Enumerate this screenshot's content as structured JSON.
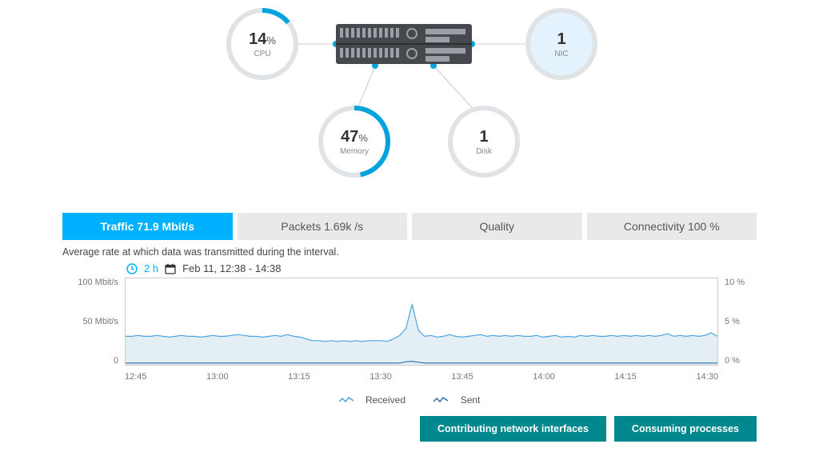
{
  "gauges": {
    "cpu": {
      "value": "14",
      "unit": "%",
      "label": "CPU",
      "pct": 14,
      "filled": false
    },
    "memory": {
      "value": "47",
      "unit": "%",
      "label": "Memory",
      "pct": 47,
      "filled": false
    },
    "disk": {
      "value": "1",
      "unit": "",
      "label": "Disk",
      "pct": 0,
      "filled": false
    },
    "nic": {
      "value": "1",
      "unit": "",
      "label": "NIC",
      "pct": 0,
      "filled": true
    }
  },
  "tabs": [
    {
      "label": "Traffic 71.9 Mbit/s",
      "active": true
    },
    {
      "label": "Packets 1.69k /s",
      "active": false
    },
    {
      "label": "Quality",
      "active": false
    },
    {
      "label": "Connectivity 100 %",
      "active": false
    }
  ],
  "chart_desc": "Average rate at which data was transmitted during the interval.",
  "time_picker": {
    "range": "2 h",
    "window": "Feb 11, 12:38 - 14:38"
  },
  "chart_data": {
    "type": "area",
    "title": "",
    "xlabel": "",
    "ylabel_left": "Mbit/s",
    "ylabel_right": "%",
    "ylim_left": [
      0,
      100
    ],
    "ylim_right": [
      0,
      10
    ],
    "y_ticks_left": [
      "100 Mbit/s",
      "50 Mbit/s",
      "0"
    ],
    "y_ticks_right": [
      "10 %",
      "5 %",
      "0 %"
    ],
    "x_ticks": [
      "12:45",
      "13:00",
      "13:15",
      "13:30",
      "13:45",
      "14:00",
      "14:15",
      "14:30"
    ],
    "series": [
      {
        "name": "Received",
        "color": "#4aa3df",
        "fill": "#e4eef5",
        "values": [
          33,
          33,
          34,
          33,
          33,
          34,
          33,
          32,
          33,
          34,
          33,
          33,
          32,
          33,
          34,
          33,
          33,
          34,
          35,
          34,
          33,
          33,
          32,
          33,
          34,
          33,
          35,
          33,
          32,
          30,
          28,
          28,
          27,
          28,
          27,
          28,
          27,
          28,
          27,
          28,
          28,
          28,
          27,
          30,
          34,
          42,
          70,
          40,
          33,
          34,
          32,
          33,
          35,
          33,
          32,
          33,
          34,
          35,
          33,
          34,
          33,
          34,
          33,
          34,
          33,
          33,
          34,
          32,
          33,
          34,
          32,
          33,
          32,
          34,
          33,
          34,
          33,
          33,
          34,
          33,
          34,
          33,
          34,
          33,
          34,
          33,
          34,
          36,
          33,
          34,
          33,
          34,
          33,
          34,
          37,
          33
        ]
      },
      {
        "name": "Sent",
        "color": "#2f6fa8",
        "fill": "none",
        "values": [
          2,
          2,
          2,
          2,
          2,
          2,
          2,
          2,
          2,
          2,
          2,
          2,
          2,
          2,
          2,
          2,
          2,
          2,
          2,
          2,
          2,
          2,
          2,
          2,
          2,
          2,
          2,
          2,
          2,
          2,
          2,
          2,
          2,
          2,
          2,
          2,
          2,
          2,
          2,
          2,
          2,
          2,
          2,
          2,
          2,
          3.5,
          4,
          3,
          2,
          2,
          2,
          2,
          2,
          2,
          2,
          2,
          2,
          2,
          2,
          2,
          2,
          2,
          2,
          2,
          2,
          2,
          2,
          2,
          2,
          2,
          2,
          2,
          2,
          2,
          2,
          2,
          2,
          2,
          2,
          2,
          2,
          2,
          2,
          2,
          2,
          2,
          2,
          2,
          2,
          2,
          2,
          2,
          2,
          2,
          2,
          2
        ]
      }
    ],
    "legend": [
      "Received",
      "Sent"
    ]
  },
  "buttons": {
    "contrib": "Contributing network interfaces",
    "consuming": "Consuming processes"
  }
}
